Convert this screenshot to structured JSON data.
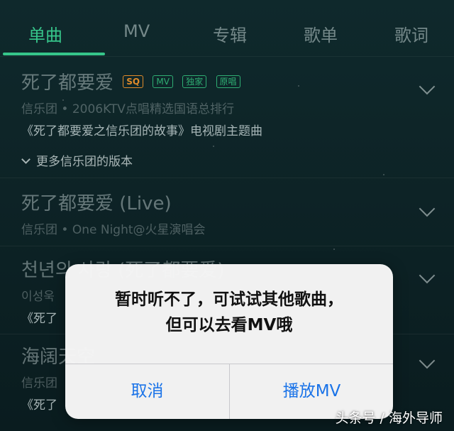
{
  "tabs": [
    {
      "label": "单曲",
      "active": true
    },
    {
      "label": "MV",
      "active": false
    },
    {
      "label": "专辑",
      "active": false
    },
    {
      "label": "歌单",
      "active": false
    },
    {
      "label": "歌词",
      "active": false
    }
  ],
  "songs": [
    {
      "title": "死了都要爱",
      "tags": [
        "SQ",
        "MV",
        "独家",
        "原唱"
      ],
      "meta": "信乐团 • 2006KTV点唱精选国语总排行",
      "desc": "《死了都要爱之信乐团的故事》电视剧主题曲"
    },
    {
      "title": "死了都要爱 (Live)",
      "meta": "信乐团 • One Night@火星演唱会"
    },
    {
      "title": "천년의 사랑 (死了都要爱)",
      "meta": "이성욱",
      "desc": "《死了"
    },
    {
      "title": "海阔天空",
      "meta": "信乐团",
      "desc": "《死了"
    }
  ],
  "more_versions": "更多信乐团的版本",
  "dialog": {
    "message_line1": "暂时听不了，可试试其他歌曲，",
    "message_line2": "但可以去看MV哦",
    "cancel_label": "取消",
    "play_mv_label": "播放MV",
    "button_color": "#1a73e8"
  },
  "watermark": "头条号 / 海外导师",
  "colors": {
    "accent_green": "#36c58a",
    "sq_tag": "#e08b2a",
    "tag_green": "#2fae73"
  }
}
